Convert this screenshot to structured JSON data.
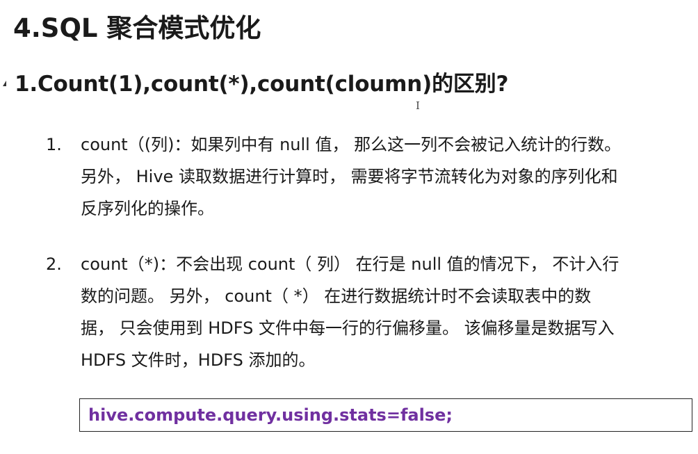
{
  "page": {
    "title": "4.SQL 聚合模式优化"
  },
  "section": {
    "heading": "1.Count(1),count(*),count(cloumn)的区别?",
    "cursor_glyph": "I"
  },
  "items": [
    {
      "number": "1.",
      "lines": [
        "count（(列)：如果列中有 null 值，  那么这一列不会被记入统计的行数。",
        "另外，  Hive 读取数据进行计算时，  需要将字节流转化为对象的序列化和",
        "反序列化的操作。"
      ]
    },
    {
      "number": "2.",
      "lines": [
        "count（*)：不会出现 count（ 列） 在行是 null 值的情况下，  不计入行",
        "数的问题。 另外，  count（ *）  在进行数据统计时不会读取表中的数",
        "据，  只会使用到 HDFS 文件中每一行的行偏移量。  该偏移量是数据写入",
        "HDFS 文件时，HDFS 添加的。"
      ]
    }
  ],
  "code": {
    "text": "hive.compute.query.using.stats=false;",
    "color": "#7030a0"
  }
}
